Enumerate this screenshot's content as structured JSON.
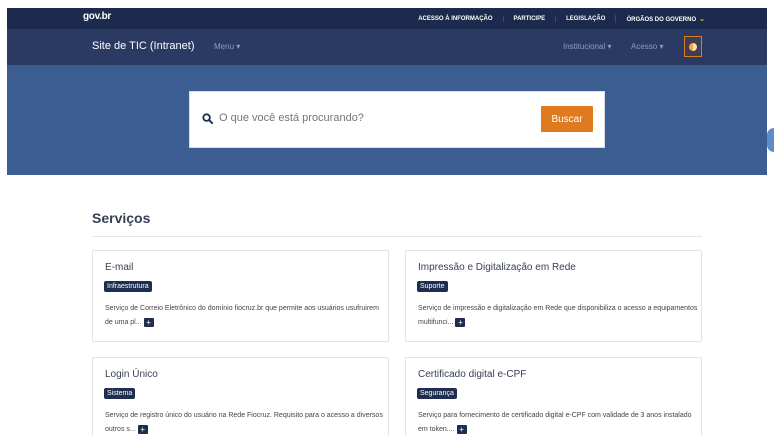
{
  "topbar": {
    "brand": "gov.br",
    "links": [
      "ACESSO À INFORMAÇÃO",
      "PARTICIPE",
      "LEGISLAÇÃO",
      "ÓRGÃOS DO GOVERNO"
    ],
    "orgaos_icon": "chevron-down-icon"
  },
  "header": {
    "site_title": "Site de TIC (Intranet)",
    "menu_label": "Menu",
    "institucional_label": "Institucional",
    "acesso_label": "Acesso",
    "contrast_icon": "contrast-icon",
    "accent_color": "#e07a1f"
  },
  "search": {
    "placeholder": "O que você está procurando?",
    "button_label": "Buscar",
    "icon": "search-icon"
  },
  "services": {
    "title": "Serviços",
    "cards": [
      {
        "title": "E-mail",
        "badge": "Infraestrutura",
        "description": "Serviço de Correio Eletrônico do domínio fiocruz.br que permite aos usuários usufruirem de uma pl...",
        "more": "+"
      },
      {
        "title": "Impressão e Digitalização em Rede",
        "badge": "Suporte",
        "description": "Serviço de impressão e digitalização em Rede que disponibiliza o acesso a equipamentos multifunci...",
        "more": "+"
      },
      {
        "title": "Login Único",
        "badge": "Sistema",
        "description": "Serviço de registro único do usuário na Rede Fiocruz. Requisito para o acesso a diversos outros s...",
        "more": "+"
      },
      {
        "title": "Certificado digital e-CPF",
        "badge": "Segurança",
        "description": "Serviço para fornecimento de certificado digital e-CPF com validade de 3 anos instalado em token....",
        "more": "+"
      }
    ]
  }
}
